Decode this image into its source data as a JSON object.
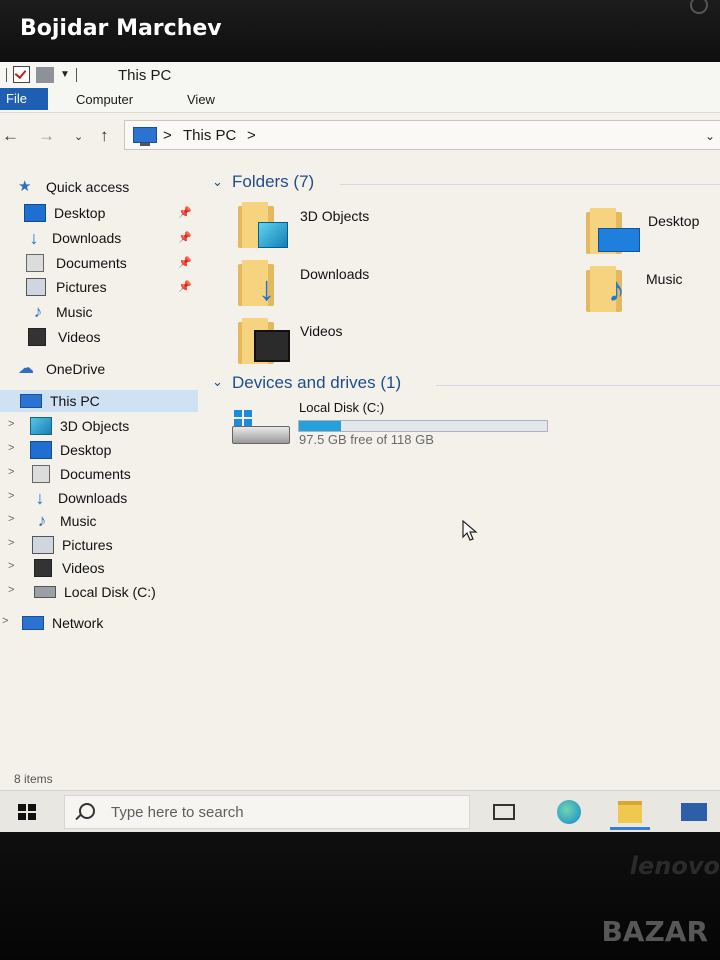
{
  "uploader": "Bojidar Marchev",
  "window": {
    "title": "This PC"
  },
  "ribbon": {
    "file": "File",
    "computer": "Computer",
    "view": "View"
  },
  "address": {
    "crumb": "This PC",
    "sep1": ">",
    "sep2": ">"
  },
  "nav": {
    "quick_access": "Quick access",
    "quick_items": [
      {
        "label": "Desktop",
        "icon": "desktop-icon",
        "pinned": true
      },
      {
        "label": "Downloads",
        "icon": "downloads-icon",
        "pinned": true
      },
      {
        "label": "Documents",
        "icon": "documents-icon",
        "pinned": true
      },
      {
        "label": "Pictures",
        "icon": "pictures-icon",
        "pinned": true
      },
      {
        "label": "Music",
        "icon": "music-icon",
        "pinned": false
      },
      {
        "label": "Videos",
        "icon": "videos-icon",
        "pinned": false
      }
    ],
    "onedrive": "OneDrive",
    "this_pc": "This PC",
    "pc_items": [
      {
        "label": "3D Objects"
      },
      {
        "label": "Desktop"
      },
      {
        "label": "Documents"
      },
      {
        "label": "Downloads"
      },
      {
        "label": "Music"
      },
      {
        "label": "Pictures"
      },
      {
        "label": "Videos"
      },
      {
        "label": "Local Disk (C:)"
      }
    ],
    "network": "Network"
  },
  "content": {
    "folders_heading": "Folders (7)",
    "folders": [
      {
        "label": "3D Objects",
        "icon": "3d-objects-icon"
      },
      {
        "label": "Desktop",
        "icon": "desktop-icon"
      },
      {
        "label": "Downloads",
        "icon": "downloads-icon"
      },
      {
        "label": "Music",
        "icon": "music-icon"
      },
      {
        "label": "Videos",
        "icon": "videos-icon"
      }
    ],
    "devices_heading": "Devices and drives (1)",
    "drive": {
      "name": "Local Disk (C:)",
      "free_text": "97.5 GB free of 118 GB",
      "used_fraction": 0.17
    }
  },
  "status": {
    "items": "8 items"
  },
  "taskbar": {
    "search_placeholder": "Type here to search"
  },
  "brand": "lenovo",
  "watermark": "BAZAR",
  "colors": {
    "accent": "#1e5fb4",
    "selection": "#cfe2f4",
    "heading": "#1f4e8c",
    "drive_fill": "#26a0da"
  }
}
